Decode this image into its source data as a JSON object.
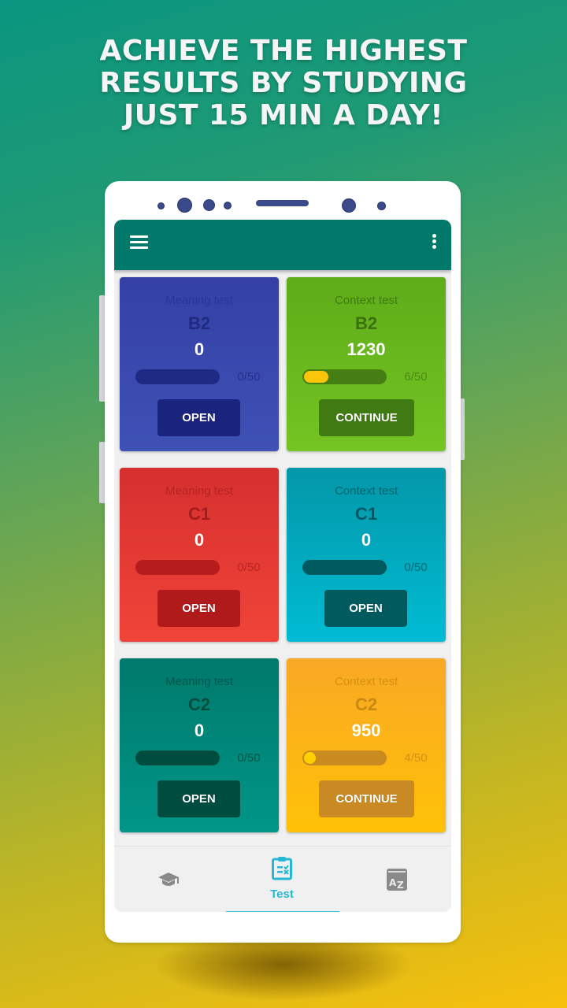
{
  "headline": {
    "lines": [
      "ACHIEVE THE HIGHEST",
      "RESULTS BY STUDYING",
      "JUST 15 MIN A DAY!"
    ]
  },
  "appbar": {
    "menu_icon": "hamburger-menu-icon",
    "overflow_icon": "more-vertical-icon",
    "color": "#00796b"
  },
  "cards": [
    {
      "title": "Meaning test",
      "level": "B2",
      "score": "0",
      "progress": 0,
      "total": 50,
      "count": "0/50",
      "button": "OPEN",
      "colors": {
        "bg_top": "#3440a6",
        "bg_bottom": "#3e51b5",
        "title": "#283593",
        "level": "#1f2a80",
        "track": "#1f2a85",
        "count": "#23308c",
        "button": "#1a237e"
      }
    },
    {
      "title": "Context test",
      "level": "B2",
      "score": "1230",
      "progress": 6,
      "total": 50,
      "count": "6/50",
      "button": "CONTINUE",
      "colors": {
        "bg_top": "#5eac18",
        "bg_bottom": "#74c423",
        "title": "#3f7a10",
        "level": "#3a7010",
        "track": "#457e12",
        "count": "#4a8a15",
        "button": "#3f7a12"
      }
    },
    {
      "title": "Meaning test",
      "level": "C1",
      "score": "0",
      "progress": 0,
      "total": 50,
      "count": "0/50",
      "button": "OPEN",
      "colors": {
        "bg_top": "#d62f2f",
        "bg_bottom": "#f04438",
        "title": "#b32424",
        "level": "#a51c1c",
        "track": "#b71c1c",
        "count": "#b82424",
        "button": "#b01a1a"
      }
    },
    {
      "title": "Context test",
      "level": "C1",
      "score": "0",
      "progress": 0,
      "total": 50,
      "count": "0/50",
      "button": "OPEN",
      "colors": {
        "bg_top": "#0397a8",
        "bg_bottom": "#00bcd4",
        "title": "#00656f",
        "level": "#005a63",
        "track": "#00595f",
        "count": "#006a75",
        "button": "#005a5e"
      }
    },
    {
      "title": "Meaning test",
      "level": "C2",
      "score": "0",
      "progress": 0,
      "total": 50,
      "count": "0/50",
      "button": "OPEN",
      "colors": {
        "bg_top": "#00796b",
        "bg_bottom": "#009688",
        "title": "#00564a",
        "level": "#004d40",
        "track": "#004d40",
        "count": "#005447",
        "button": "#004d40"
      }
    },
    {
      "title": "Context test",
      "level": "C2",
      "score": "950",
      "progress": 4,
      "total": 50,
      "count": "4/50",
      "button": "CONTINUE",
      "colors": {
        "bg_top": "#f9a825",
        "bg_bottom": "#ffc107",
        "title": "#d49010",
        "level": "#c98a14",
        "track": "#c98a20",
        "count": "#d49018",
        "button": "#c98a24"
      }
    }
  ],
  "bottom_nav": {
    "items": [
      {
        "icon": "graduation-cap-icon",
        "label": "",
        "active": false
      },
      {
        "icon": "clipboard-test-icon",
        "label": "Test",
        "active": true
      },
      {
        "icon": "dictionary-az-icon",
        "label": "",
        "active": false
      }
    ],
    "active_color": "#26b8d3",
    "inactive_color": "#8a8a8a"
  }
}
